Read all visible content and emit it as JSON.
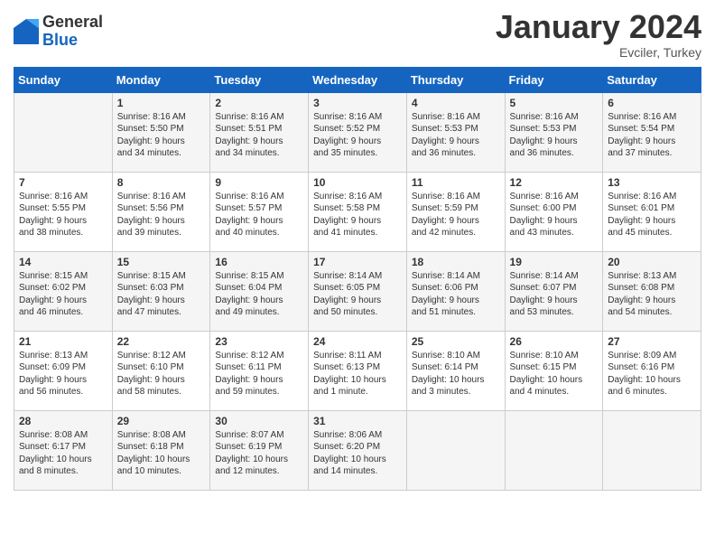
{
  "header": {
    "logo_general": "General",
    "logo_blue": "Blue",
    "month_title": "January 2024",
    "location": "Evciler, Turkey"
  },
  "days_of_week": [
    "Sunday",
    "Monday",
    "Tuesday",
    "Wednesday",
    "Thursday",
    "Friday",
    "Saturday"
  ],
  "weeks": [
    [
      {
        "day": "",
        "info": ""
      },
      {
        "day": "1",
        "info": "Sunrise: 8:16 AM\nSunset: 5:50 PM\nDaylight: 9 hours\nand 34 minutes."
      },
      {
        "day": "2",
        "info": "Sunrise: 8:16 AM\nSunset: 5:51 PM\nDaylight: 9 hours\nand 34 minutes."
      },
      {
        "day": "3",
        "info": "Sunrise: 8:16 AM\nSunset: 5:52 PM\nDaylight: 9 hours\nand 35 minutes."
      },
      {
        "day": "4",
        "info": "Sunrise: 8:16 AM\nSunset: 5:53 PM\nDaylight: 9 hours\nand 36 minutes."
      },
      {
        "day": "5",
        "info": "Sunrise: 8:16 AM\nSunset: 5:53 PM\nDaylight: 9 hours\nand 36 minutes."
      },
      {
        "day": "6",
        "info": "Sunrise: 8:16 AM\nSunset: 5:54 PM\nDaylight: 9 hours\nand 37 minutes."
      }
    ],
    [
      {
        "day": "7",
        "info": "Sunrise: 8:16 AM\nSunset: 5:55 PM\nDaylight: 9 hours\nand 38 minutes."
      },
      {
        "day": "8",
        "info": "Sunrise: 8:16 AM\nSunset: 5:56 PM\nDaylight: 9 hours\nand 39 minutes."
      },
      {
        "day": "9",
        "info": "Sunrise: 8:16 AM\nSunset: 5:57 PM\nDaylight: 9 hours\nand 40 minutes."
      },
      {
        "day": "10",
        "info": "Sunrise: 8:16 AM\nSunset: 5:58 PM\nDaylight: 9 hours\nand 41 minutes."
      },
      {
        "day": "11",
        "info": "Sunrise: 8:16 AM\nSunset: 5:59 PM\nDaylight: 9 hours\nand 42 minutes."
      },
      {
        "day": "12",
        "info": "Sunrise: 8:16 AM\nSunset: 6:00 PM\nDaylight: 9 hours\nand 43 minutes."
      },
      {
        "day": "13",
        "info": "Sunrise: 8:16 AM\nSunset: 6:01 PM\nDaylight: 9 hours\nand 45 minutes."
      }
    ],
    [
      {
        "day": "14",
        "info": "Sunrise: 8:15 AM\nSunset: 6:02 PM\nDaylight: 9 hours\nand 46 minutes."
      },
      {
        "day": "15",
        "info": "Sunrise: 8:15 AM\nSunset: 6:03 PM\nDaylight: 9 hours\nand 47 minutes."
      },
      {
        "day": "16",
        "info": "Sunrise: 8:15 AM\nSunset: 6:04 PM\nDaylight: 9 hours\nand 49 minutes."
      },
      {
        "day": "17",
        "info": "Sunrise: 8:14 AM\nSunset: 6:05 PM\nDaylight: 9 hours\nand 50 minutes."
      },
      {
        "day": "18",
        "info": "Sunrise: 8:14 AM\nSunset: 6:06 PM\nDaylight: 9 hours\nand 51 minutes."
      },
      {
        "day": "19",
        "info": "Sunrise: 8:14 AM\nSunset: 6:07 PM\nDaylight: 9 hours\nand 53 minutes."
      },
      {
        "day": "20",
        "info": "Sunrise: 8:13 AM\nSunset: 6:08 PM\nDaylight: 9 hours\nand 54 minutes."
      }
    ],
    [
      {
        "day": "21",
        "info": "Sunrise: 8:13 AM\nSunset: 6:09 PM\nDaylight: 9 hours\nand 56 minutes."
      },
      {
        "day": "22",
        "info": "Sunrise: 8:12 AM\nSunset: 6:10 PM\nDaylight: 9 hours\nand 58 minutes."
      },
      {
        "day": "23",
        "info": "Sunrise: 8:12 AM\nSunset: 6:11 PM\nDaylight: 9 hours\nand 59 minutes."
      },
      {
        "day": "24",
        "info": "Sunrise: 8:11 AM\nSunset: 6:13 PM\nDaylight: 10 hours\nand 1 minute."
      },
      {
        "day": "25",
        "info": "Sunrise: 8:10 AM\nSunset: 6:14 PM\nDaylight: 10 hours\nand 3 minutes."
      },
      {
        "day": "26",
        "info": "Sunrise: 8:10 AM\nSunset: 6:15 PM\nDaylight: 10 hours\nand 4 minutes."
      },
      {
        "day": "27",
        "info": "Sunrise: 8:09 AM\nSunset: 6:16 PM\nDaylight: 10 hours\nand 6 minutes."
      }
    ],
    [
      {
        "day": "28",
        "info": "Sunrise: 8:08 AM\nSunset: 6:17 PM\nDaylight: 10 hours\nand 8 minutes."
      },
      {
        "day": "29",
        "info": "Sunrise: 8:08 AM\nSunset: 6:18 PM\nDaylight: 10 hours\nand 10 minutes."
      },
      {
        "day": "30",
        "info": "Sunrise: 8:07 AM\nSunset: 6:19 PM\nDaylight: 10 hours\nand 12 minutes."
      },
      {
        "day": "31",
        "info": "Sunrise: 8:06 AM\nSunset: 6:20 PM\nDaylight: 10 hours\nand 14 minutes."
      },
      {
        "day": "",
        "info": ""
      },
      {
        "day": "",
        "info": ""
      },
      {
        "day": "",
        "info": ""
      }
    ]
  ]
}
